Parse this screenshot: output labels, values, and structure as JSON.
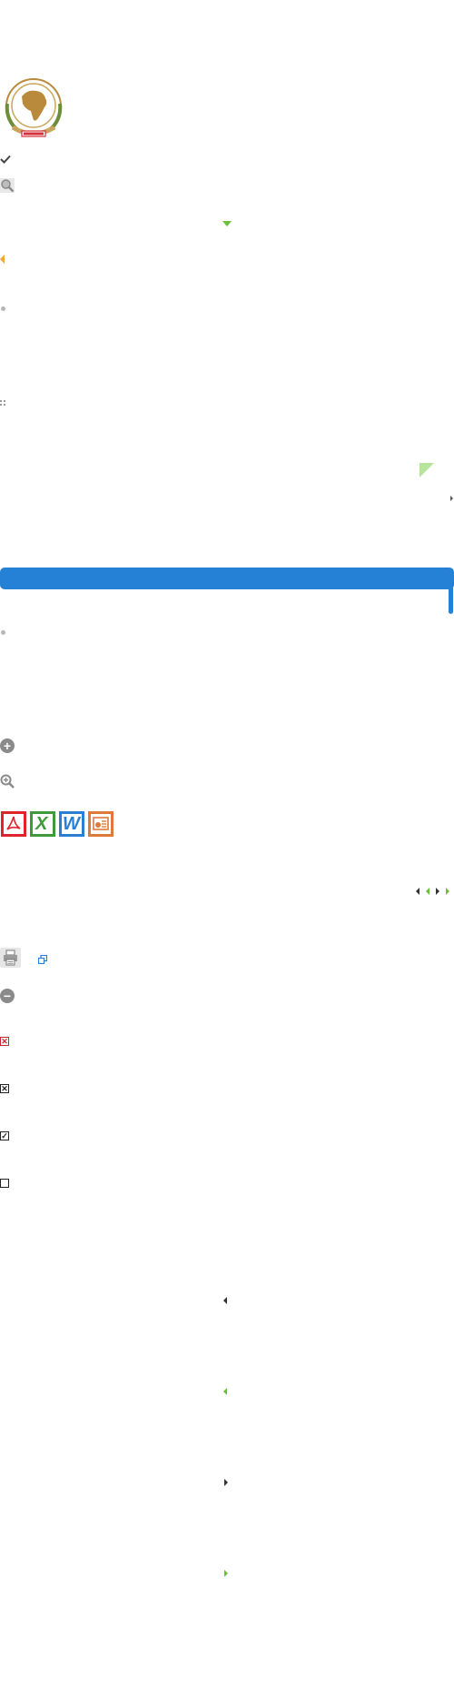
{
  "icons": {
    "logo": "african-union-emblem",
    "check": "check-icon",
    "search": "magnifier-icon",
    "dropdown": "triangle-down-icon",
    "collapse": "triangle-left-icon",
    "bullet": "bullet-icon",
    "drag": "drag-handle-icon",
    "corner": "corner-fold-icon",
    "expand": "triangle-right-icon",
    "add": "plus-circle-icon",
    "zoom_in": "zoom-in-icon",
    "pdf": "pdf-icon",
    "excel": "excel-icon",
    "word": "word-icon",
    "powerpoint": "powerpoint-icon",
    "pager": [
      "first-page-icon",
      "prev-page-icon",
      "next-page-icon",
      "last-page-icon"
    ],
    "print": "printer-icon",
    "new_window": "new-window-icon",
    "remove": "minus-circle-icon",
    "checkbox_error": "checkbox-x-red-icon",
    "checkbox_x": "checkbox-x-icon",
    "checkbox_checked": "checkbox-checked-icon",
    "checkbox_empty": "checkbox-empty-icon"
  },
  "colors": {
    "accent_blue": "#2481d6",
    "accent_green": "#6bbf3a",
    "accent_orange": "#f0a830",
    "pdf_red": "#e0242b",
    "excel_green": "#3f9a3b",
    "word_blue": "#2a7fd4",
    "ppt_orange": "#dd7a3a",
    "logo_gold": "#b98a3b"
  },
  "labels": {
    "excel_letter": "X",
    "word_letter": "W"
  }
}
